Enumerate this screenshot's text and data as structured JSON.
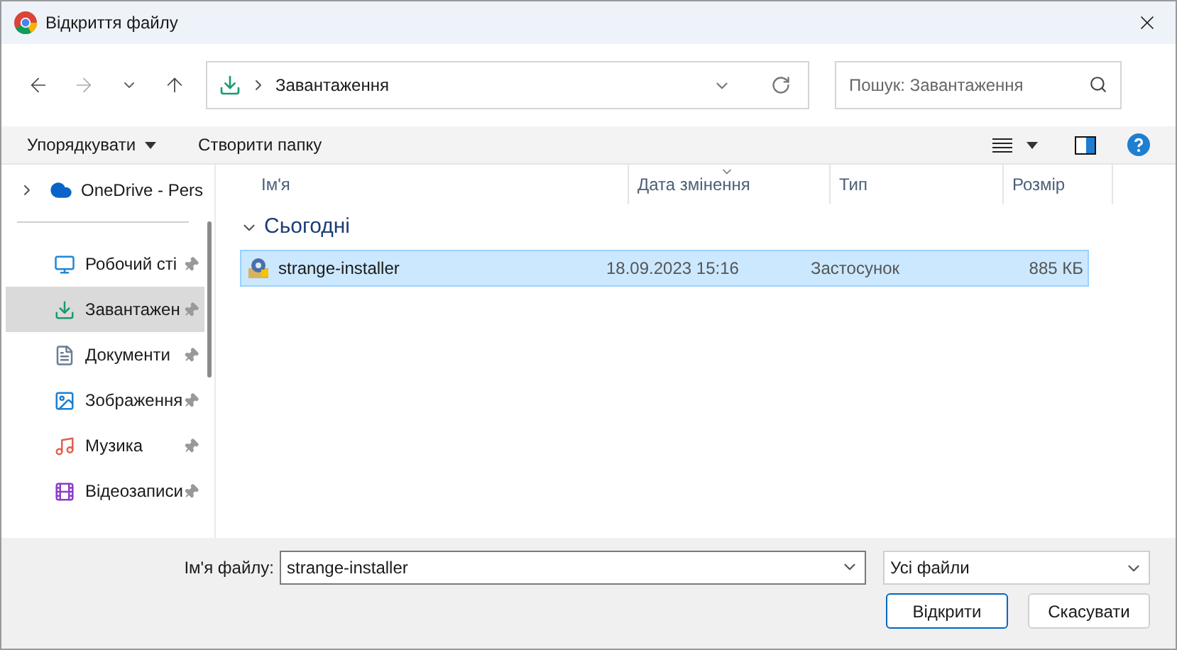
{
  "window": {
    "title": "Відкриття файлу"
  },
  "address": {
    "path": "Завантаження"
  },
  "search": {
    "placeholder": "Пошук: Завантаження"
  },
  "toolbar": {
    "organize": "Упорядкувати",
    "new_folder": "Створити папку"
  },
  "sidebar": {
    "top": {
      "label": "OneDrive - Pers",
      "expanded": false
    },
    "items": [
      {
        "label": "Робочий сті",
        "kind": "desktop",
        "selected": false
      },
      {
        "label": "Завантажен",
        "kind": "download",
        "selected": true
      },
      {
        "label": "Документи",
        "kind": "documents",
        "selected": false
      },
      {
        "label": "Зображення",
        "kind": "pictures",
        "selected": false
      },
      {
        "label": "Музика",
        "kind": "music",
        "selected": false
      },
      {
        "label": "Відеозаписи",
        "kind": "videos",
        "selected": false
      }
    ]
  },
  "table": {
    "columns": [
      "Ім'я",
      "Дата змінення",
      "Тип",
      "Розмір"
    ],
    "group": {
      "label": "Сьогодні",
      "expanded": true
    },
    "rows": [
      {
        "name": "strange-installer",
        "date": "18.09.2023 15:16",
        "type": "Застосунок",
        "size": "885 КБ",
        "selected": true
      }
    ]
  },
  "footer": {
    "filename_label": "Ім'я файлу:",
    "filename": "strange-installer",
    "filter": "Усі файли",
    "open": "Відкрити",
    "cancel": "Скасувати"
  }
}
